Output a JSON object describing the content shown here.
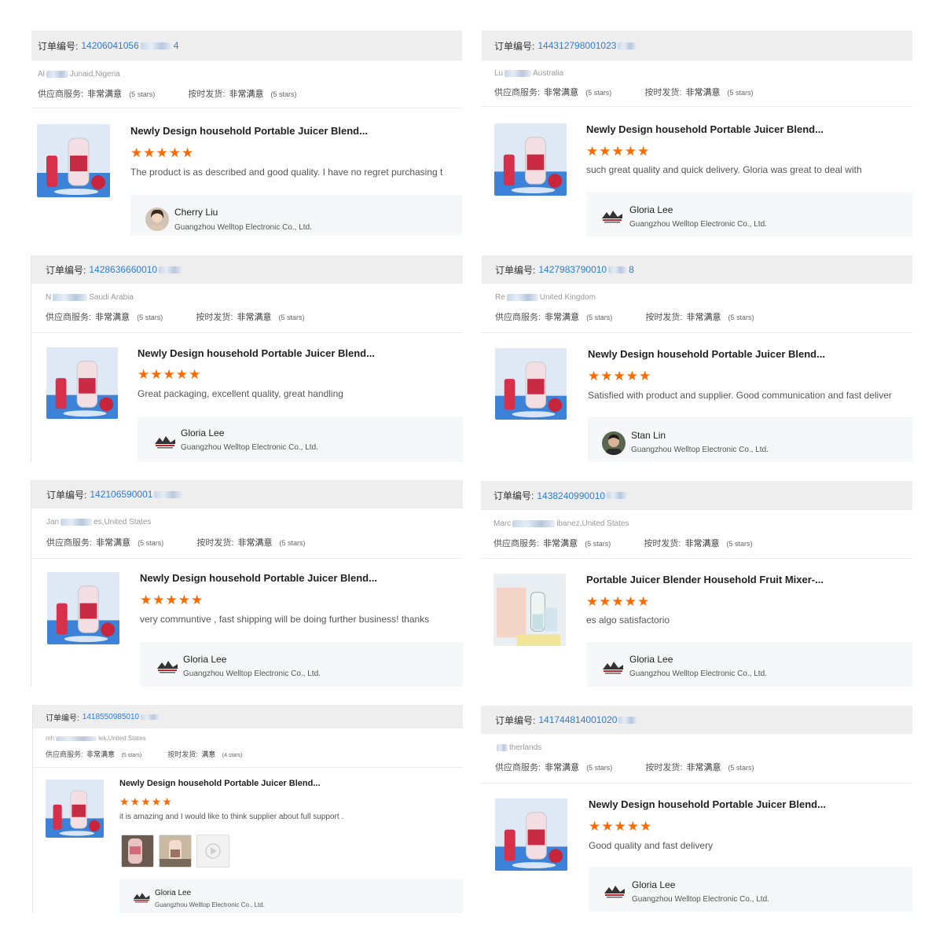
{
  "common": {
    "order_label": "订单编号:",
    "supplier_service_label": "供应商服务:",
    "ontime_label": "按时发货:",
    "very_satisfied": "非常满意",
    "satisfied": "满意",
    "five_stars": "(5 stars)",
    "four_stars": "(4 stars)",
    "company": "Guangzhou Welltop Electronic Co., Ltd.",
    "stars5": "★★★★★",
    "star_color": "#ff6a00",
    "link_color": "#2f7bd6"
  },
  "reviews": [
    {
      "order_number": "14206041056",
      "order_suffix": "4",
      "buyer_prefix": "Al",
      "buyer_suffix": "Junaid,Nigeria",
      "product": "Newly Design household Portable Juicer Blend...",
      "rating": 5,
      "text": "The product is as described and good quality. I have no regret purchasing t",
      "responder": "Cherry Liu",
      "responder_avatar": "person-avatar"
    },
    {
      "order_number": "144312798001023",
      "order_suffix": "",
      "buyer_prefix": "Lu",
      "buyer_suffix": "Australia",
      "product": "Newly Design household Portable Juicer Blend...",
      "rating": 5,
      "text": "such great quality and quick delivery. Gloria was great to deal with",
      "responder": "Gloria Lee",
      "responder_avatar": "company-logo"
    },
    {
      "order_number": "1428636660010",
      "order_suffix": "",
      "buyer_prefix": "N",
      "buyer_suffix": "Saudi Arabia",
      "product": "Newly Design household Portable Juicer Blend...",
      "rating": 5,
      "text": "Great packaging, excellent quality, great handling",
      "responder": "Gloria Lee",
      "responder_avatar": "company-logo"
    },
    {
      "order_number": "1427983790010",
      "order_suffix": "8",
      "buyer_prefix": "Re",
      "buyer_suffix": "United Kingdom",
      "product": "Newly Design household Portable Juicer Blend...",
      "rating": 5,
      "text": "Satisfied with product and supplier. Good communication and fast deliver",
      "responder": "Stan Lin",
      "responder_avatar": "person-avatar"
    },
    {
      "order_number": "142106590001",
      "order_suffix": "",
      "buyer_prefix": "Jan",
      "buyer_suffix": "es,United States",
      "product": "Newly Design household Portable Juicer Blend...",
      "rating": 5,
      "text": "very communtive , fast shipping will be doing further business! thanks",
      "responder": "Gloria Lee",
      "responder_avatar": "company-logo"
    },
    {
      "order_number": "1438240990010",
      "order_suffix": "",
      "buyer_prefix": "Marc",
      "buyer_suffix": "ibanez,United States",
      "product": "Portable Juicer Blender Household Fruit Mixer-...",
      "rating": 5,
      "text": "es algo satisfactorio",
      "responder": "Gloria Lee",
      "responder_avatar": "company-logo"
    },
    {
      "order_number": "1418550985010",
      "order_suffix": "",
      "buyer_prefix": "mh",
      "buyer_suffix": "lek,United States",
      "product": "Newly Design household Portable Juicer Blend...",
      "rating": 5,
      "ontime_stars": 4,
      "text": "it is amazing and I would like to think supplier about full support .",
      "responder": "Gloria Lee",
      "responder_avatar": "company-logo"
    },
    {
      "order_number": "141744814001020",
      "order_suffix": "",
      "buyer_prefix": "",
      "buyer_suffix": "therlands",
      "product": "Newly Design household Portable Juicer Blend...",
      "rating": 5,
      "text": "Good quality and fast delivery",
      "responder": "Gloria Lee",
      "responder_avatar": "company-logo"
    }
  ]
}
